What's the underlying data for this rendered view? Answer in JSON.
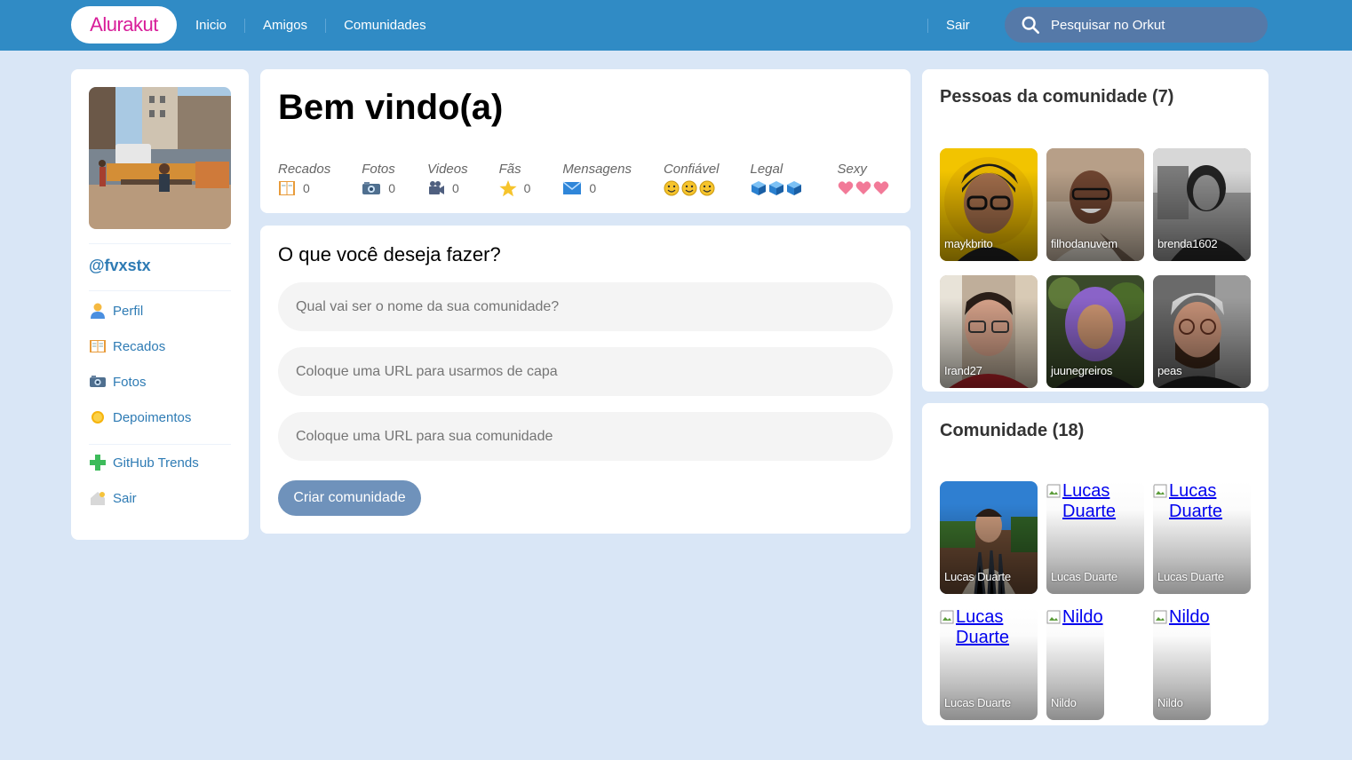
{
  "header": {
    "logo": "Alurakut",
    "nav": [
      "Inicio",
      "Amigos",
      "Comunidades"
    ],
    "logout": "Sair",
    "search_placeholder": "Pesquisar no Orkut"
  },
  "sidebar": {
    "handle": "@fvxstx",
    "menu": [
      {
        "label": "Perfil",
        "icon": "user-icon"
      },
      {
        "label": "Recados",
        "icon": "book-icon"
      },
      {
        "label": "Fotos",
        "icon": "camera-icon"
      },
      {
        "label": "Depoimentos",
        "icon": "sun-icon"
      }
    ],
    "menu2": [
      {
        "label": "GitHub Trends",
        "icon": "plus-icon"
      },
      {
        "label": "Sair",
        "icon": "logout-icon"
      }
    ]
  },
  "welcome": {
    "title": "Bem vindo(a)",
    "stats": [
      {
        "label": "Recados",
        "value": "0",
        "icon": "book-icon"
      },
      {
        "label": "Fotos",
        "value": "0",
        "icon": "camera-icon"
      },
      {
        "label": "Videos",
        "value": "0",
        "icon": "video-camera-icon"
      },
      {
        "label": "Fãs",
        "value": "0",
        "icon": "star-icon"
      },
      {
        "label": "Mensagens",
        "value": "0",
        "icon": "envelope-icon"
      },
      {
        "label": "Confiável",
        "icon": "smiley-icon",
        "level": 3
      },
      {
        "label": "Legal",
        "icon": "cube-icon",
        "level": 3
      },
      {
        "label": "Sexy",
        "icon": "heart-icon",
        "level": 3
      }
    ]
  },
  "form": {
    "title": "O que você deseja fazer?",
    "fields": [
      "Qual vai ser o nome da sua comunidade?",
      "Coloque uma URL para usarmos de capa",
      "Coloque uma URL para sua comunidade"
    ],
    "submit": "Criar comunidade"
  },
  "people": {
    "title": "Pessoas da comunidade (7)",
    "items": [
      "maykbrito",
      "filhodanuvem",
      "brenda1602",
      "Irand27",
      "juunegreiros",
      "peas"
    ]
  },
  "communities": {
    "title": "Comunidade (18)",
    "items": [
      {
        "name": "Lucas Duarte",
        "alt": ""
      },
      {
        "name": "Lucas Duarte",
        "alt": "Lucas Duarte"
      },
      {
        "name": "Lucas Duarte",
        "alt": "Lucas Duarte"
      },
      {
        "name": "Lucas Duarte",
        "alt": "Lucas Duarte"
      },
      {
        "name": "Nildo",
        "alt": "Nildo"
      },
      {
        "name": "Nildo",
        "alt": "Nildo"
      }
    ]
  },
  "colors": {
    "header": "#308bc5",
    "background": "#d9e6f6",
    "link": "#2e7bb4",
    "logo": "#d81d99",
    "button": "#6f92bb"
  }
}
